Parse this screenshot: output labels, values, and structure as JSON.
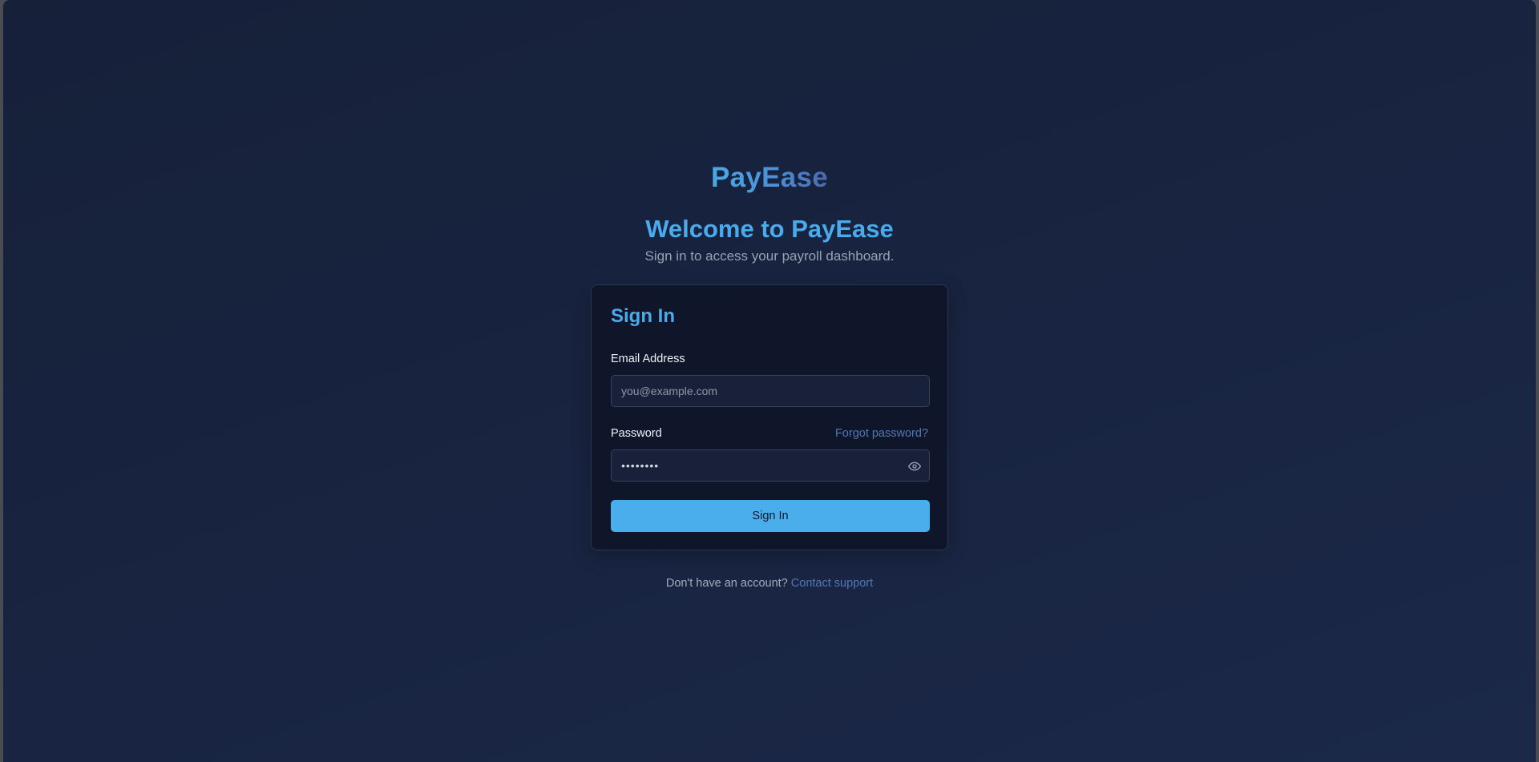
{
  "brand": {
    "logo_text": "PayEase"
  },
  "hero": {
    "title": "Welcome to PayEase",
    "subtitle": "Sign in to access your payroll dashboard."
  },
  "form": {
    "title": "Sign In",
    "email": {
      "label": "Email Address",
      "placeholder": "you@example.com",
      "value": ""
    },
    "password": {
      "label": "Password",
      "masked_value": "••••••••",
      "forgot_link": "Forgot password?",
      "toggle_icon": "eye-icon"
    },
    "submit_label": "Sign In"
  },
  "footer": {
    "prompt": "Don't have an account?",
    "link": "Contact support"
  },
  "colors": {
    "accent": "#4aaeec",
    "link": "#4f78b8",
    "background": "#182441",
    "card": "#0f1629"
  }
}
